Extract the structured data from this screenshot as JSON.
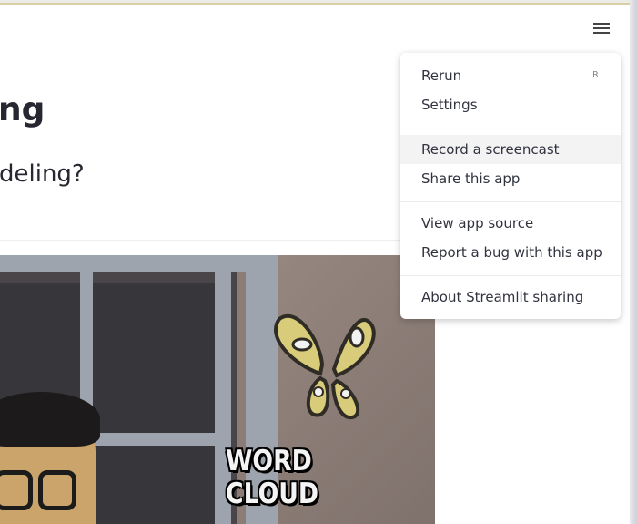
{
  "app": {
    "title_partial": "ng",
    "subtitle_partial": "deling?"
  },
  "menu_button": {
    "icon": "hamburger-menu-icon"
  },
  "image": {
    "caption_overlay": "WORD CLOUD"
  },
  "menu": {
    "items": [
      {
        "label": "Rerun",
        "shortcut": "R"
      },
      {
        "label": "Settings"
      },
      {
        "label": "Record a screencast"
      },
      {
        "label": "Share this app"
      },
      {
        "label": "View app source"
      },
      {
        "label": "Report a bug with this app"
      },
      {
        "label": "About Streamlit sharing"
      }
    ]
  },
  "colors": {
    "accent_line": "#d8cfa3",
    "text": "#31333f",
    "hover_bg": "#f3f3f3"
  }
}
